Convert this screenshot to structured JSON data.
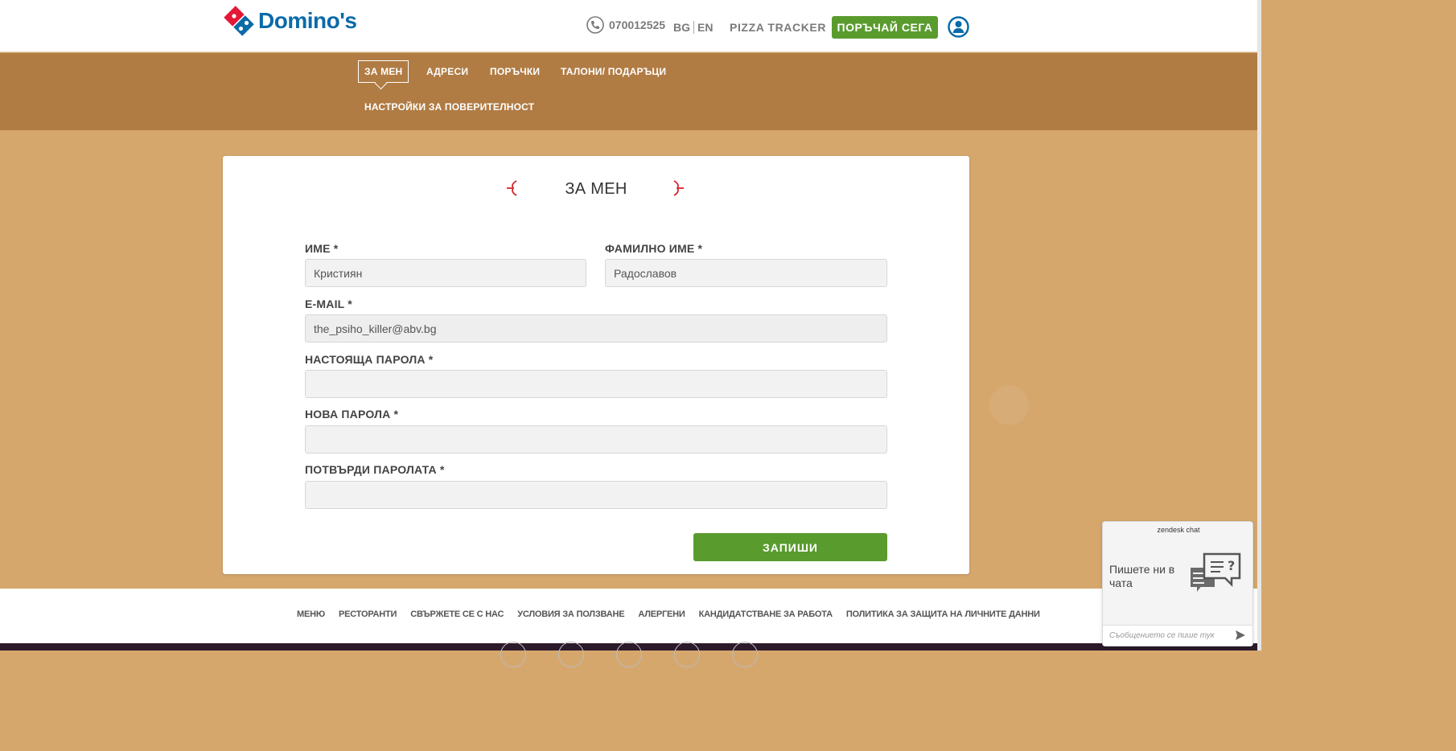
{
  "header": {
    "brand": "Domino's",
    "phone": "070012525",
    "lang_bg": "BG",
    "lang_en": "EN",
    "tracker": "PIZZA TRACKER",
    "order_now": "ПОРЪЧАЙ СЕГА"
  },
  "subnav": {
    "items": [
      {
        "label": "ЗА МЕН"
      },
      {
        "label": "АДРЕСИ"
      },
      {
        "label": "ПОРЪЧКИ"
      },
      {
        "label": "ТАЛОНИ/ ПОДАРЪЦИ"
      },
      {
        "label": "НАСТРОЙКИ ЗА ПОВЕРИТЕЛНОСТ"
      }
    ]
  },
  "form": {
    "title": "ЗА МЕН",
    "first_name_label": "ИМЕ *",
    "first_name_value": "Кристиян",
    "last_name_label": "ФАМИЛНО ИМЕ *",
    "last_name_value": "Радославов",
    "email_label": "E-MAIL *",
    "email_value": "the_psiho_killer@abv.bg",
    "current_password_label": "НАСТОЯЩА ПАРОЛА *",
    "new_password_label": "НОВА ПАРОЛА *",
    "confirm_password_label": "ПОТВЪРДИ ПАРОЛАТА *",
    "save_label": "ЗАПИШИ"
  },
  "footer": {
    "links": [
      "МЕНЮ",
      "РЕСТОРАНТИ",
      "СВЪРЖЕТЕ СЕ С НАС",
      "УСЛОВИЯ ЗА ПОЛЗВАНЕ",
      "АЛЕРГЕНИ",
      "КАНДИДАТСТВАНЕ ЗА РАБОТА",
      "ПОЛИТИКА ЗА ЗАЩИТА НА ЛИЧНИТЕ ДАННИ"
    ]
  },
  "chat": {
    "brand": "zendesk chat",
    "prompt": "Пишете ни в чата",
    "input_placeholder": "Съобщението се пише тук"
  },
  "colors": {
    "brand_blue": "#0b6aa8",
    "brand_red": "#e31837",
    "green": "#5a9b2e",
    "band_brown": "#b07c44",
    "tan": "#d6a76d"
  }
}
